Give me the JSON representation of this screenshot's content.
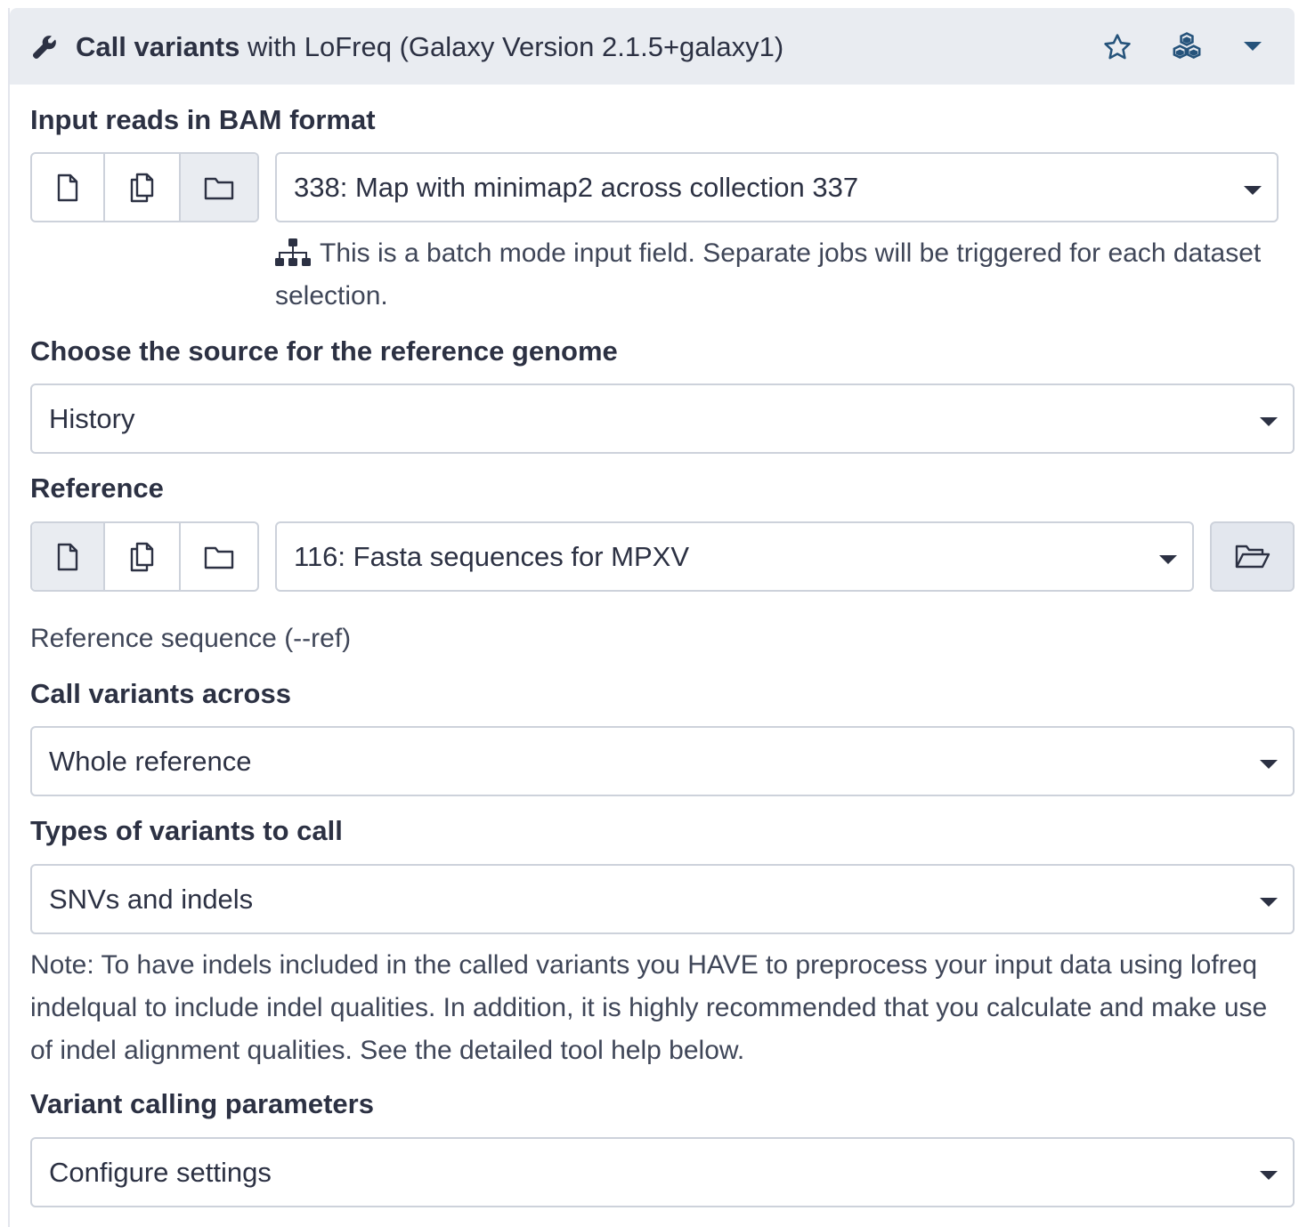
{
  "header": {
    "tool_name": "Call variants",
    "tool_desc": " with LoFreq (Galaxy Version 2.1.5+galaxy1)",
    "icons": [
      "wrench-icon",
      "star-icon",
      "cubes-icon",
      "caret-down-icon"
    ]
  },
  "input_reads": {
    "label": "Input reads in BAM format",
    "selected": "338: Map with minimap2 across collection 337",
    "batch_note": "This is a batch mode input field. Separate jobs will be triggered for each dataset selection."
  },
  "reference_source": {
    "label": "Choose the source for the reference genome",
    "selected": "History"
  },
  "reference": {
    "label": "Reference",
    "selected": "116: Fasta sequences for MPXV",
    "help": "Reference sequence (--ref)"
  },
  "call_across": {
    "label": "Call variants across",
    "selected": "Whole reference"
  },
  "variant_types": {
    "label": "Types of variants to call",
    "selected": "SNVs and indels",
    "note": "Note: To have indels included in the called variants you HAVE to preprocess your input data using lofreq indelqual to include indel qualities. In addition, it is highly recommended that you calculate and make use of indel alignment qualities. See the detailed tool help below."
  },
  "calling_params": {
    "label": "Variant calling parameters",
    "selected": "Configure settings"
  },
  "colors": {
    "text": "#2c3143",
    "header_bg": "#e9ecf1",
    "border": "#cdd2db",
    "icon_blue": "#25537b"
  }
}
